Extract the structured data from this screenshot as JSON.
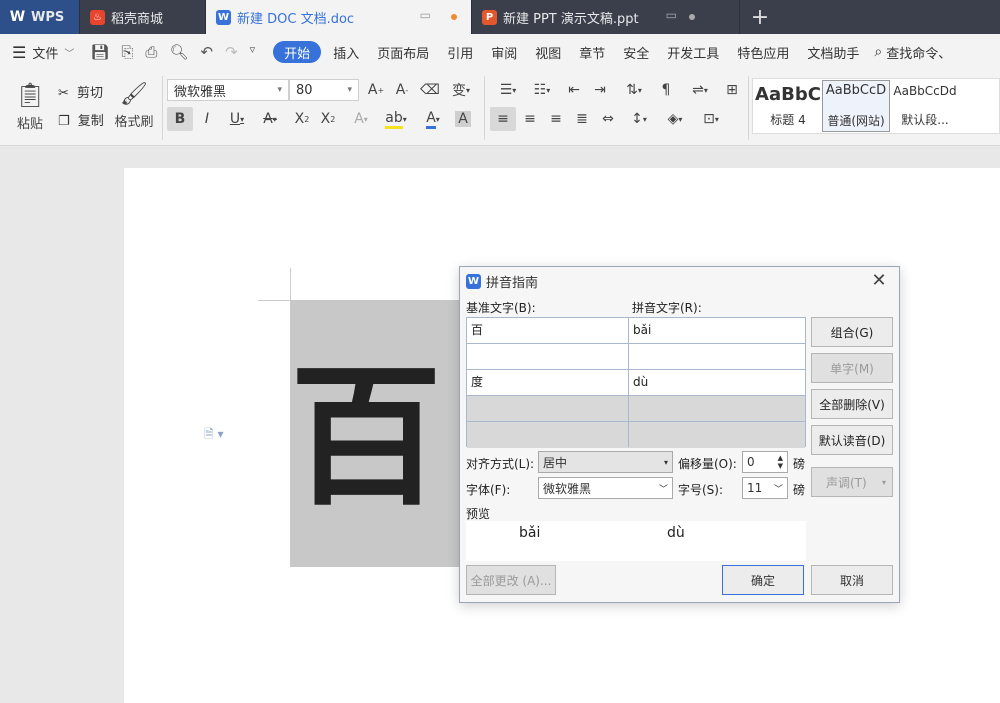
{
  "tabs": [
    {
      "label": "WPS",
      "icon": "wps-logo-icon"
    },
    {
      "label": "稻壳商城",
      "icon": "docer-flame-icon"
    },
    {
      "label": "新建 DOC 文档.doc",
      "icon": "writer-doc-icon"
    },
    {
      "label": "新建 PPT 演示文稿.ppt",
      "icon": "presentation-icon"
    }
  ],
  "menu": {
    "file": "文件",
    "items": [
      "开始",
      "插入",
      "页面布局",
      "引用",
      "审阅",
      "视图",
      "章节",
      "安全",
      "开发工具",
      "特色应用",
      "文档助手"
    ],
    "search": "查找命令、"
  },
  "ribbon": {
    "paste": "粘贴",
    "cut": "剪切",
    "copy": "复制",
    "format_painter": "格式刷",
    "font_name": "微软雅黑",
    "font_size": "80",
    "styles": [
      {
        "sample": "AaBbC",
        "name": "标题 4"
      },
      {
        "sample": "AaBbCcD",
        "name": "普通(网站)"
      },
      {
        "sample": "AaBbCcDd",
        "name": "默认段..."
      }
    ]
  },
  "document": {
    "big_char": "百"
  },
  "dialog": {
    "title": "拼音指南",
    "base_label": "基准文字(B):",
    "ruby_label": "拼音文字(R):",
    "rows": [
      {
        "base": "百",
        "ruby": "bǎi"
      },
      {
        "base": "",
        "ruby": ""
      },
      {
        "base": "度",
        "ruby": "dù"
      },
      {
        "base": "",
        "ruby": ""
      },
      {
        "base": "",
        "ruby": ""
      }
    ],
    "buttons": {
      "group": "组合(G)",
      "single": "单字(M)",
      "clear_all": "全部删除(V)",
      "default_reading": "默认读音(D)",
      "tone": "声调(T)"
    },
    "align_label": "对齐方式(L):",
    "align_value": "居中",
    "offset_label": "偏移量(O):",
    "offset_value": "0",
    "offset_unit": "磅",
    "font_label": "字体(F):",
    "font_value": "微软雅黑",
    "size_label": "字号(S):",
    "size_value": "11",
    "size_unit": "磅",
    "preview_label": "预览",
    "preview": [
      "bǎi",
      "dù"
    ],
    "apply_all": "全部更改 (A)...",
    "ok": "确定",
    "cancel": "取消"
  },
  "colors": {
    "accent": "#3672d9",
    "tabbar": "#3a3f4b",
    "docer": "#e8452c",
    "ppt": "#e2572c"
  }
}
